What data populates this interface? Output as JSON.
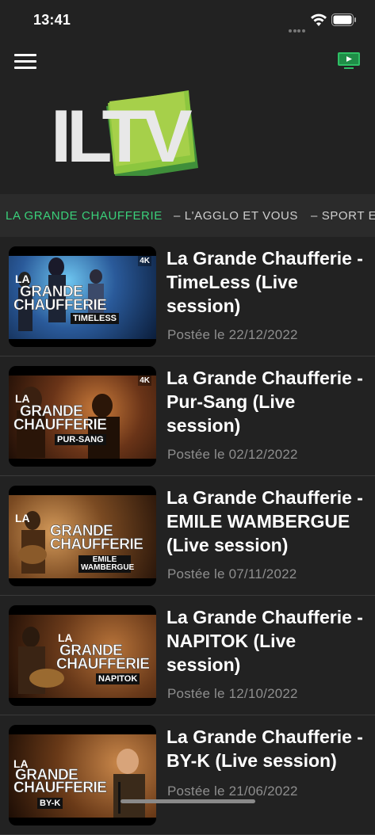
{
  "status_bar": {
    "time": "13:41"
  },
  "header": {
    "logo_text": "ILTV"
  },
  "categories": [
    "LA GRANDE CHAUFFERIE",
    "– L'AGGLO ET VOUS",
    "– SPORT E"
  ],
  "colors": {
    "accent": "#3ad07a",
    "background": "#222222",
    "date_text": "#8e8e8e"
  },
  "videos": [
    {
      "title": "La Grande Chaufferie - TimeLess (Live session)",
      "date": "Postée le 22/12/2022",
      "thumb_brand": [
        "LA",
        "GRANDE",
        "CHAUFFERIE"
      ],
      "thumb_sub": "TIMELESS",
      "badge": "4K"
    },
    {
      "title": "La Grande Chaufferie - Pur-Sang (Live session)",
      "date": "Postée le 02/12/2022",
      "thumb_brand": [
        "LA",
        "GRANDE",
        "CHAUFFERIE"
      ],
      "thumb_sub": "PUR-SANG",
      "badge": "4K"
    },
    {
      "title": "La Grande Chaufferie - EMILE WAMBERGUE (Live session)",
      "date": "Postée le 07/11/2022",
      "thumb_brand": [
        "LA",
        "GRANDE",
        "CHAUFFERIE"
      ],
      "thumb_sub": "EMILE WAMBERGUE",
      "badge": ""
    },
    {
      "title": "La Grande Chaufferie - NAPITOK (Live session)",
      "date": "Postée le 12/10/2022",
      "thumb_brand": [
        "LA",
        "GRANDE",
        "CHAUFFERIE"
      ],
      "thumb_sub": "NAPITOK",
      "badge": ""
    },
    {
      "title": "La Grande Chaufferie - BY-K  (Live session)",
      "date": "Postée le 21/06/2022",
      "thumb_brand": [
        "LA",
        "GRANDE",
        "CHAUFFERIE"
      ],
      "thumb_sub": "BY-K",
      "badge": ""
    }
  ]
}
